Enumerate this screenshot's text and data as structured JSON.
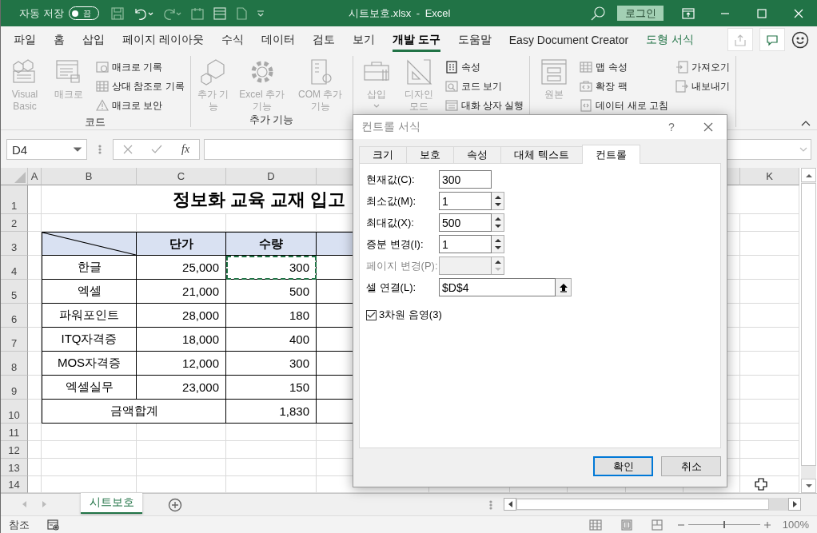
{
  "title_bar": {
    "autosave_label": "자동 저장",
    "autosave": {
      "label": "끔",
      "on": false
    },
    "title": "시트보호.xlsx - Excel",
    "login": "로그인"
  },
  "menu_tabs": [
    {
      "label": "파일",
      "selected": false,
      "kind": "normal"
    },
    {
      "label": "홈",
      "selected": false,
      "kind": "normal"
    },
    {
      "label": "삽입",
      "selected": false,
      "kind": "normal"
    },
    {
      "label": "페이지 레이아웃",
      "selected": false,
      "kind": "normal"
    },
    {
      "label": "수식",
      "selected": false,
      "kind": "normal"
    },
    {
      "label": "데이터",
      "selected": false,
      "kind": "normal"
    },
    {
      "label": "검토",
      "selected": false,
      "kind": "normal"
    },
    {
      "label": "보기",
      "selected": false,
      "kind": "normal"
    },
    {
      "label": "개발 도구",
      "selected": true,
      "kind": "normal"
    },
    {
      "label": "도움말",
      "selected": false,
      "kind": "normal"
    },
    {
      "label": "Easy Document Creator",
      "selected": false,
      "kind": "normal"
    },
    {
      "label": "도형 서식",
      "selected": false,
      "kind": "contextual"
    }
  ],
  "ribbon": {
    "groups": [
      {
        "label": "코드",
        "large": [
          {
            "label": "Visual Basic",
            "disabled": true,
            "kind": "button"
          },
          {
            "label": "매크로",
            "disabled": true,
            "kind": "button"
          }
        ],
        "small": [
          [
            {
              "label": "매크로 기록",
              "disabled": true
            },
            {
              "label": "상대 참조로 기록",
              "disabled": true
            },
            {
              "label": "매크로 보안",
              "disabled": true
            }
          ]
        ]
      },
      {
        "label": "추가 기능",
        "large": [
          {
            "label": "추가 기능",
            "disabled": true,
            "kind": "button"
          },
          {
            "label": "Excel 추가 기능",
            "disabled": true,
            "kind": "button"
          },
          {
            "label": "COM 추가 기능",
            "disabled": true,
            "kind": "button"
          }
        ]
      },
      {
        "large": [
          {
            "label": "삽입",
            "disabled": true,
            "kind": "menu"
          },
          {
            "label": "디자인 모드",
            "disabled": true,
            "kind": "button"
          }
        ],
        "small": [
          [
            {
              "label": "속성",
              "disabled": false
            },
            {
              "label": "코드 보기",
              "disabled": true
            },
            {
              "label": "대화 상자 실행",
              "disabled": true
            }
          ]
        ]
      },
      {
        "large": [
          {
            "label": "원본",
            "disabled": true,
            "kind": "button"
          }
        ],
        "small": [
          [
            {
              "label": "맵 속성",
              "disabled": true
            },
            {
              "label": "확장 팩",
              "disabled": true
            },
            {
              "label": "데이터 새로 고침",
              "disabled": true
            }
          ],
          [
            {
              "label": "가져오기",
              "disabled": true
            },
            {
              "label": "내보내기",
              "disabled": true
            }
          ]
        ]
      }
    ]
  },
  "formula_bar": {
    "name_box": "D4",
    "function_label": "fx"
  },
  "sheet": {
    "column_headers": [
      "A",
      "B",
      "C",
      "D",
      "K"
    ],
    "row_headers": [
      "1",
      "2",
      "3",
      "4",
      "5",
      "6",
      "7",
      "8",
      "9",
      "10",
      "11",
      "12",
      "13",
      "14"
    ],
    "title": "정보화 교육 교재 입고",
    "header": [
      "단가",
      "수량"
    ],
    "rows": [
      {
        "item": "한글",
        "price": "25,000",
        "quantity": "300",
        "copy_marquee": true
      },
      {
        "item": "엑셀",
        "price": "21,000",
        "quantity": "500",
        "copy_marquee": false
      },
      {
        "item": "파워포인트",
        "price": "28,000",
        "quantity": "180",
        "copy_marquee": false
      },
      {
        "item": "ITQ자격증",
        "price": "18,000",
        "quantity": "400",
        "copy_marquee": false
      },
      {
        "item": "MOS자격증",
        "price": "12,000",
        "quantity": "300",
        "copy_marquee": false
      },
      {
        "item": "엑셀실무",
        "price": "23,000",
        "quantity": "150",
        "copy_marquee": false
      }
    ],
    "total": {
      "label": "금액합계",
      "quantity": "1,830"
    }
  },
  "dialog": {
    "title": "컨트롤 서식",
    "help": "?",
    "tabs": [
      {
        "label": "크기",
        "selected": false
      },
      {
        "label": "보호",
        "selected": false
      },
      {
        "label": "속성",
        "selected": false
      },
      {
        "label": "대체 텍스트",
        "selected": false
      },
      {
        "label": "컨트롤",
        "selected": true
      }
    ],
    "fields": [
      {
        "label": "현재값(C):",
        "value": "300",
        "kind": "text",
        "disabled": false
      },
      {
        "label": "최소값(M):",
        "value": "1",
        "kind": "spin",
        "disabled": false
      },
      {
        "label": "최대값(X):",
        "value": "500",
        "kind": "spin",
        "disabled": false
      },
      {
        "label": "증분 변경(I):",
        "value": "1",
        "kind": "spin",
        "disabled": false
      },
      {
        "label": "페이지 변경(P):",
        "kind": "spin",
        "disabled": true
      },
      {
        "label": "셀 연결(L):",
        "value": "$D$4",
        "kind": "reference",
        "disabled": false
      }
    ],
    "checkbox": {
      "label": "3차원 음영(3)",
      "checked": true
    },
    "buttons": [
      {
        "label": "확인",
        "kind": "default"
      },
      {
        "label": "취소",
        "kind": "normal"
      }
    ]
  },
  "sheet_tabs": [
    {
      "label": "시트보호",
      "selected": true
    }
  ],
  "status_bar": {
    "mode": "참조",
    "zoom": {
      "level": 0.5
    },
    "zoom_label": "100%"
  }
}
